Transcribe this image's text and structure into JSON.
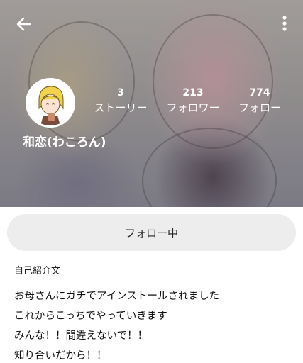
{
  "header": {
    "back_icon": "arrow-left-icon",
    "menu_icon": "more-vertical-icon",
    "avatar_icon": "avatar-illustration"
  },
  "profile": {
    "username": "和恋(わころん)",
    "stats": [
      {
        "value": "3",
        "label": "ストーリー"
      },
      {
        "value": "213",
        "label": "フォロワー"
      },
      {
        "value": "774",
        "label": "フォロー"
      }
    ],
    "follow_button_label": "フォロー中"
  },
  "bio": {
    "heading": "自己紹介文",
    "lines": [
      "お母さんにガチでアインストールされました",
      "これからこっちでやっていきます",
      "みんな！！間違えないで！！",
      "知り合いだから！！"
    ]
  },
  "colors": {
    "button_bg": "#ededed",
    "header_text": "#ffffff",
    "body_text": "#111111"
  }
}
